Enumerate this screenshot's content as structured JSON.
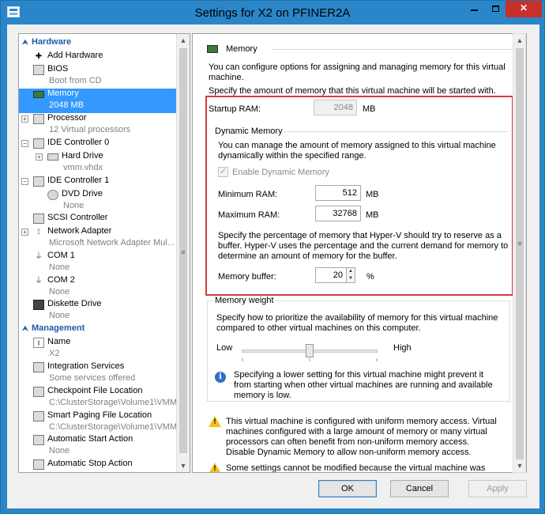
{
  "window": {
    "title": "Settings for X2 on PFINER2A",
    "minimize_label": "",
    "maximize_label": "",
    "close_label": "✕"
  },
  "sidebar": {
    "sections": [
      {
        "label": "Hardware"
      },
      {
        "label": "Management"
      }
    ],
    "hardware_items": [
      {
        "label": "Add Hardware",
        "sub": ""
      },
      {
        "label": "BIOS",
        "sub": "Boot from CD"
      },
      {
        "label": "Memory",
        "sub": "2048 MB"
      },
      {
        "label": "Processor",
        "sub": "12 Virtual processors"
      },
      {
        "label": "IDE Controller 0",
        "sub": ""
      },
      {
        "label": "Hard Drive",
        "sub": "vmm.vhdx"
      },
      {
        "label": "IDE Controller 1",
        "sub": ""
      },
      {
        "label": "DVD Drive",
        "sub": "None"
      },
      {
        "label": "SCSI Controller",
        "sub": ""
      },
      {
        "label": "Network Adapter",
        "sub": "Microsoft Network Adapter Mul..."
      },
      {
        "label": "COM 1",
        "sub": "None"
      },
      {
        "label": "COM 2",
        "sub": "None"
      },
      {
        "label": "Diskette Drive",
        "sub": "None"
      }
    ],
    "management_items": [
      {
        "label": "Name",
        "sub": "X2"
      },
      {
        "label": "Integration Services",
        "sub": "Some services offered"
      },
      {
        "label": "Checkpoint File Location",
        "sub": "C:\\ClusterStorage\\Volume1\\VMM"
      },
      {
        "label": "Smart Paging File Location",
        "sub": "C:\\ClusterStorage\\Volume1\\VMM"
      },
      {
        "label": "Automatic Start Action",
        "sub": "None"
      },
      {
        "label": "Automatic Stop Action",
        "sub": ""
      }
    ],
    "selected": "Memory"
  },
  "memory": {
    "heading": "Memory",
    "intro": "You can configure options for assigning and managing memory for this virtual machine.",
    "specify": "Specify the amount of memory that this virtual machine will be started with.",
    "startup_label": "Startup RAM:",
    "startup_value": "2048",
    "unit_mb": "MB",
    "dynamic_heading": "Dynamic Memory",
    "dynamic_desc": "You can manage the amount of memory assigned to this virtual machine dynamically within the specified range.",
    "enable_dynamic_label": "Enable Dynamic Memory",
    "enable_dynamic_checked": true,
    "min_label": "Minimum RAM:",
    "min_value": "512",
    "max_label": "Maximum RAM:",
    "max_value": "32768",
    "buffer_desc": "Specify the percentage of memory that Hyper-V should try to reserve as a buffer. Hyper-V uses the percentage and the current demand for memory to determine an amount of memory for the buffer.",
    "buffer_label": "Memory buffer:",
    "buffer_value": "20",
    "buffer_unit": "%",
    "weight_heading": "Memory weight",
    "weight_desc": "Specify how to prioritize the availability of memory for this virtual machine compared to other virtual machines on this computer.",
    "weight_low": "Low",
    "weight_high": "High",
    "weight_level": 0.5,
    "weight_info": "Specifying a lower setting for this virtual machine might prevent it from starting when other virtual machines are running and available memory is low.",
    "warning1": "This virtual machine is configured with uniform memory access. Virtual machines configured with a large amount of memory or many virtual processors can often benefit from non-uniform memory access.",
    "warning1b": "Disable Dynamic Memory to allow non-uniform memory access.",
    "warning2": "Some settings cannot be modified because the virtual machine was running"
  },
  "buttons": {
    "ok": "OK",
    "cancel": "Cancel",
    "apply": "Apply"
  },
  "colors": {
    "titlebar": "#2a86c8",
    "selection": "#3399ff",
    "highlight_border": "#d43d3d",
    "section_heading": "#1e5aa8"
  }
}
